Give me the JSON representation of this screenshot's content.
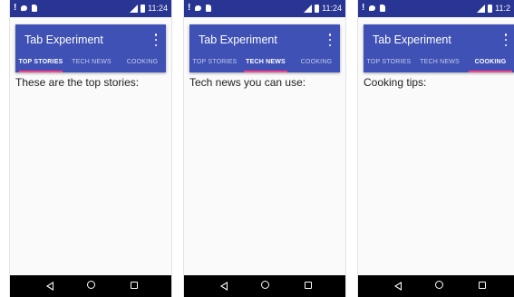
{
  "status_bar": {
    "left_glyphs": [
      "!"
    ],
    "time": "11:24",
    "time_partial": "11:2"
  },
  "app": {
    "title": "Tab Experiment"
  },
  "tabs": [
    {
      "label": "TOP STORIES"
    },
    {
      "label": "TECH NEWS"
    },
    {
      "label": "COOKING"
    }
  ],
  "screens": [
    {
      "active_tab": "TOP STORIES",
      "content": "These are the top stories:"
    },
    {
      "active_tab": "TECH NEWS",
      "content": "Tech news you can use:"
    },
    {
      "active_tab": "COOKING",
      "content": "Cooking tips:"
    }
  ],
  "colors": {
    "status_bar": "#283593",
    "app_bar": "#3f51b5",
    "tab_indicator": "#ff4081",
    "nav_bar": "#000000"
  },
  "icons": {
    "status_left": [
      "notification-alert-icon",
      "chat-icon",
      "sim-card-icon"
    ],
    "status_right": [
      "signal-icon",
      "battery-icon"
    ],
    "app_bar": [
      "overflow-menu-icon"
    ],
    "nav": [
      "back-icon",
      "home-icon",
      "recents-icon"
    ]
  }
}
